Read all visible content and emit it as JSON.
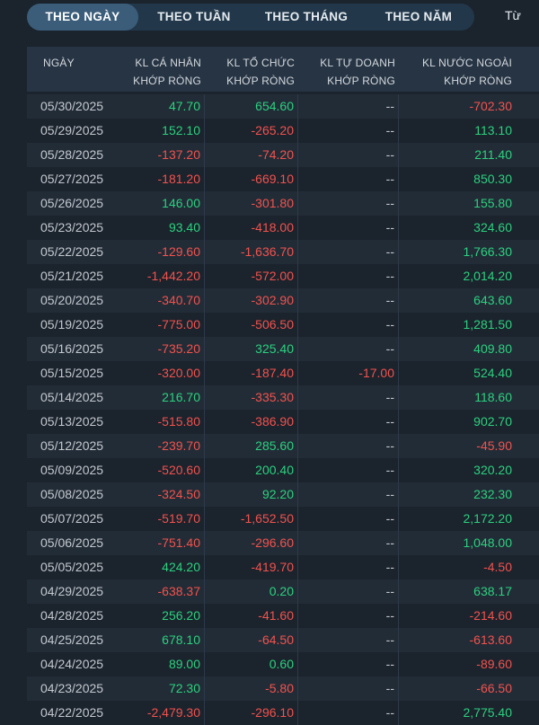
{
  "tabs": [
    {
      "label": "THEO NGÀY",
      "active": true
    },
    {
      "label": "THEO TUẦN",
      "active": false
    },
    {
      "label": "THEO THÁNG",
      "active": false
    },
    {
      "label": "THEO NĂM",
      "active": false
    }
  ],
  "from_label": "Từ",
  "colors": {
    "positive": "#2bd17e",
    "negative": "#f2524d",
    "neutral": "#c4c8ce",
    "active_tab": "#3b5d79"
  },
  "table": {
    "headers": {
      "date": "NGÀY",
      "individual": [
        "KL CÁ NHÂN",
        "KHỚP RÒNG"
      ],
      "institutional": [
        "KL TỔ CHỨC",
        "KHỚP RÒNG"
      ],
      "proprietary": [
        "KL TỰ DOANH",
        "KHỚP RÒNG"
      ],
      "foreign": [
        "KL NƯỚC NGOÀI",
        "KHỚP RÒNG"
      ]
    },
    "rows": [
      {
        "date": "05/30/2025",
        "individual": "47.70",
        "institutional": "654.60",
        "proprietary": "--",
        "foreign": "-702.30"
      },
      {
        "date": "05/29/2025",
        "individual": "152.10",
        "institutional": "-265.20",
        "proprietary": "--",
        "foreign": "113.10"
      },
      {
        "date": "05/28/2025",
        "individual": "-137.20",
        "institutional": "-74.20",
        "proprietary": "--",
        "foreign": "211.40"
      },
      {
        "date": "05/27/2025",
        "individual": "-181.20",
        "institutional": "-669.10",
        "proprietary": "--",
        "foreign": "850.30"
      },
      {
        "date": "05/26/2025",
        "individual": "146.00",
        "institutional": "-301.80",
        "proprietary": "--",
        "foreign": "155.80"
      },
      {
        "date": "05/23/2025",
        "individual": "93.40",
        "institutional": "-418.00",
        "proprietary": "--",
        "foreign": "324.60"
      },
      {
        "date": "05/22/2025",
        "individual": "-129.60",
        "institutional": "-1,636.70",
        "proprietary": "--",
        "foreign": "1,766.30"
      },
      {
        "date": "05/21/2025",
        "individual": "-1,442.20",
        "institutional": "-572.00",
        "proprietary": "--",
        "foreign": "2,014.20"
      },
      {
        "date": "05/20/2025",
        "individual": "-340.70",
        "institutional": "-302.90",
        "proprietary": "--",
        "foreign": "643.60"
      },
      {
        "date": "05/19/2025",
        "individual": "-775.00",
        "institutional": "-506.50",
        "proprietary": "--",
        "foreign": "1,281.50"
      },
      {
        "date": "05/16/2025",
        "individual": "-735.20",
        "institutional": "325.40",
        "proprietary": "--",
        "foreign": "409.80"
      },
      {
        "date": "05/15/2025",
        "individual": "-320.00",
        "institutional": "-187.40",
        "proprietary": "-17.00",
        "foreign": "524.40"
      },
      {
        "date": "05/14/2025",
        "individual": "216.70",
        "institutional": "-335.30",
        "proprietary": "--",
        "foreign": "118.60"
      },
      {
        "date": "05/13/2025",
        "individual": "-515.80",
        "institutional": "-386.90",
        "proprietary": "--",
        "foreign": "902.70"
      },
      {
        "date": "05/12/2025",
        "individual": "-239.70",
        "institutional": "285.60",
        "proprietary": "--",
        "foreign": "-45.90"
      },
      {
        "date": "05/09/2025",
        "individual": "-520.60",
        "institutional": "200.40",
        "proprietary": "--",
        "foreign": "320.20"
      },
      {
        "date": "05/08/2025",
        "individual": "-324.50",
        "institutional": "92.20",
        "proprietary": "--",
        "foreign": "232.30"
      },
      {
        "date": "05/07/2025",
        "individual": "-519.70",
        "institutional": "-1,652.50",
        "proprietary": "--",
        "foreign": "2,172.20"
      },
      {
        "date": "05/06/2025",
        "individual": "-751.40",
        "institutional": "-296.60",
        "proprietary": "--",
        "foreign": "1,048.00"
      },
      {
        "date": "05/05/2025",
        "individual": "424.20",
        "institutional": "-419.70",
        "proprietary": "--",
        "foreign": "-4.50"
      },
      {
        "date": "04/29/2025",
        "individual": "-638.37",
        "institutional": "0.20",
        "proprietary": "--",
        "foreign": "638.17"
      },
      {
        "date": "04/28/2025",
        "individual": "256.20",
        "institutional": "-41.60",
        "proprietary": "--",
        "foreign": "-214.60"
      },
      {
        "date": "04/25/2025",
        "individual": "678.10",
        "institutional": "-64.50",
        "proprietary": "--",
        "foreign": "-613.60"
      },
      {
        "date": "04/24/2025",
        "individual": "89.00",
        "institutional": "0.60",
        "proprietary": "--",
        "foreign": "-89.60"
      },
      {
        "date": "04/23/2025",
        "individual": "72.30",
        "institutional": "-5.80",
        "proprietary": "--",
        "foreign": "-66.50"
      },
      {
        "date": "04/22/2025",
        "individual": "-2,479.30",
        "institutional": "-296.10",
        "proprietary": "--",
        "foreign": "2,775.40"
      }
    ]
  }
}
